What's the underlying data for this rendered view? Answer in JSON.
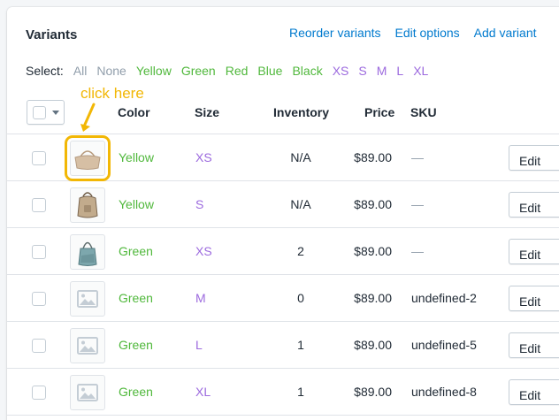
{
  "header": {
    "title": "Variants",
    "actions": [
      "Reorder variants",
      "Edit options",
      "Add variant"
    ]
  },
  "select": {
    "label": "Select:",
    "options": [
      {
        "label": "All",
        "color": "#919eab"
      },
      {
        "label": "None",
        "color": "#919eab"
      },
      {
        "label": "Yellow",
        "color": "#50b83c"
      },
      {
        "label": "Green",
        "color": "#50b83c"
      },
      {
        "label": "Red",
        "color": "#50b83c"
      },
      {
        "label": "Blue",
        "color": "#50b83c"
      },
      {
        "label": "Black",
        "color": "#50b83c"
      },
      {
        "label": "XS",
        "color": "#9c6ade"
      },
      {
        "label": "S",
        "color": "#9c6ade"
      },
      {
        "label": "M",
        "color": "#9c6ade"
      },
      {
        "label": "L",
        "color": "#9c6ade"
      },
      {
        "label": "XL",
        "color": "#9c6ade"
      }
    ]
  },
  "columns": {
    "color": "Color",
    "size": "Size",
    "inventory": "Inventory",
    "price": "Price",
    "sku": "SKU"
  },
  "annotation": "click here",
  "rows": [
    {
      "image": "bag-yellow",
      "color": "Yellow",
      "size": "XS",
      "inventory": "N/A",
      "price": "$89.00",
      "sku": "—",
      "edit": "Edit"
    },
    {
      "image": "backpack-yellow",
      "color": "Yellow",
      "size": "S",
      "inventory": "N/A",
      "price": "$89.00",
      "sku": "—",
      "edit": "Edit"
    },
    {
      "image": "bag-green",
      "color": "Green",
      "size": "XS",
      "inventory": "2",
      "price": "$89.00",
      "sku": "—",
      "edit": "Edit"
    },
    {
      "image": "placeholder",
      "color": "Green",
      "size": "M",
      "inventory": "0",
      "price": "$89.00",
      "sku": "undefined-2",
      "edit": "Edit"
    },
    {
      "image": "placeholder",
      "color": "Green",
      "size": "L",
      "inventory": "1",
      "price": "$89.00",
      "sku": "undefined-5",
      "edit": "Edit"
    },
    {
      "image": "placeholder",
      "color": "Green",
      "size": "XL",
      "inventory": "1",
      "price": "$89.00",
      "sku": "undefined-8",
      "edit": "Edit"
    }
  ]
}
